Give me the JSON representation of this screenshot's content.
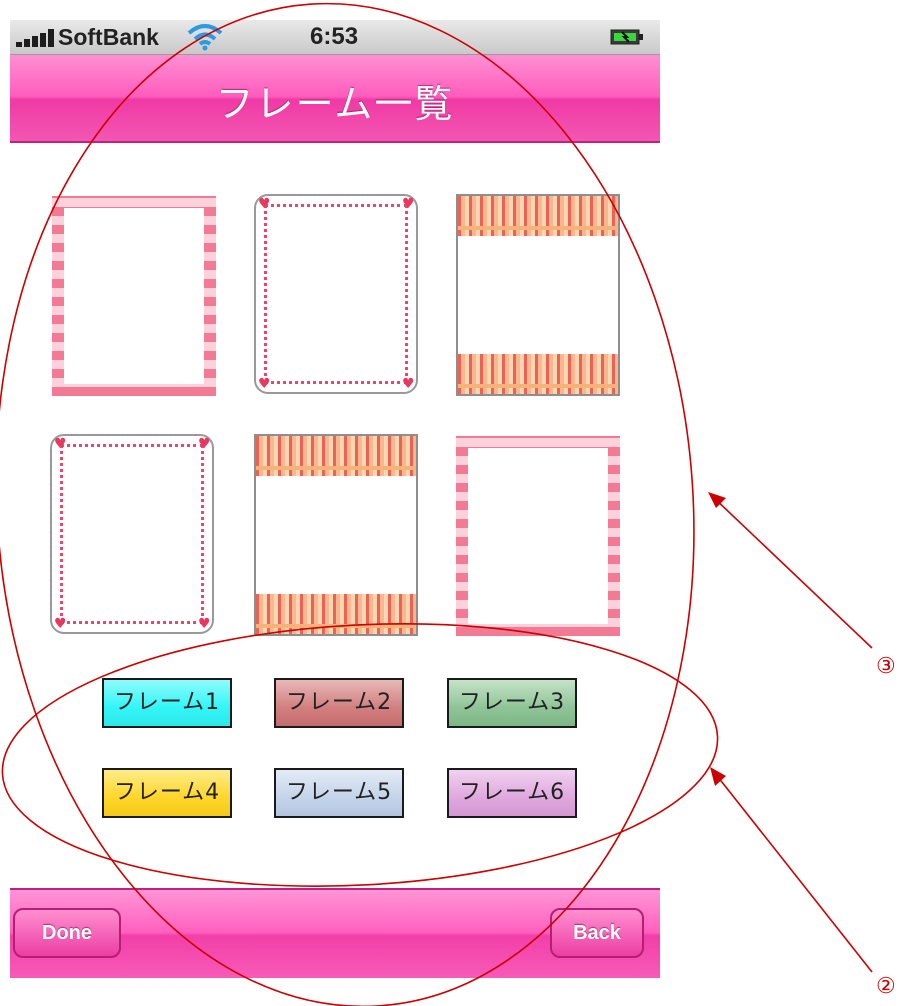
{
  "status_bar": {
    "carrier": "SoftBank",
    "time": "6:53"
  },
  "nav": {
    "title": "フレーム一覧"
  },
  "frames": [
    {
      "style": "gingham"
    },
    {
      "style": "dotted-hearts"
    },
    {
      "style": "floral"
    },
    {
      "style": "dotted-hearts"
    },
    {
      "style": "floral"
    },
    {
      "style": "gingham"
    }
  ],
  "frame_buttons": [
    {
      "label": "フレーム1",
      "color": "#33f5f7"
    },
    {
      "label": "フレーム2",
      "color": "#d27f80"
    },
    {
      "label": "フレーム3",
      "color": "#8fc497"
    },
    {
      "label": "フレーム4",
      "color": "#ffd62a"
    },
    {
      "label": "フレーム5",
      "color": "#c4d4ea"
    },
    {
      "label": "フレーム6",
      "color": "#dfa8de"
    }
  ],
  "toolbar": {
    "done_label": "Done",
    "back_label": "Back"
  },
  "annotations": {
    "label_3": "③",
    "label_2": "②",
    "color": "#cc0000"
  }
}
